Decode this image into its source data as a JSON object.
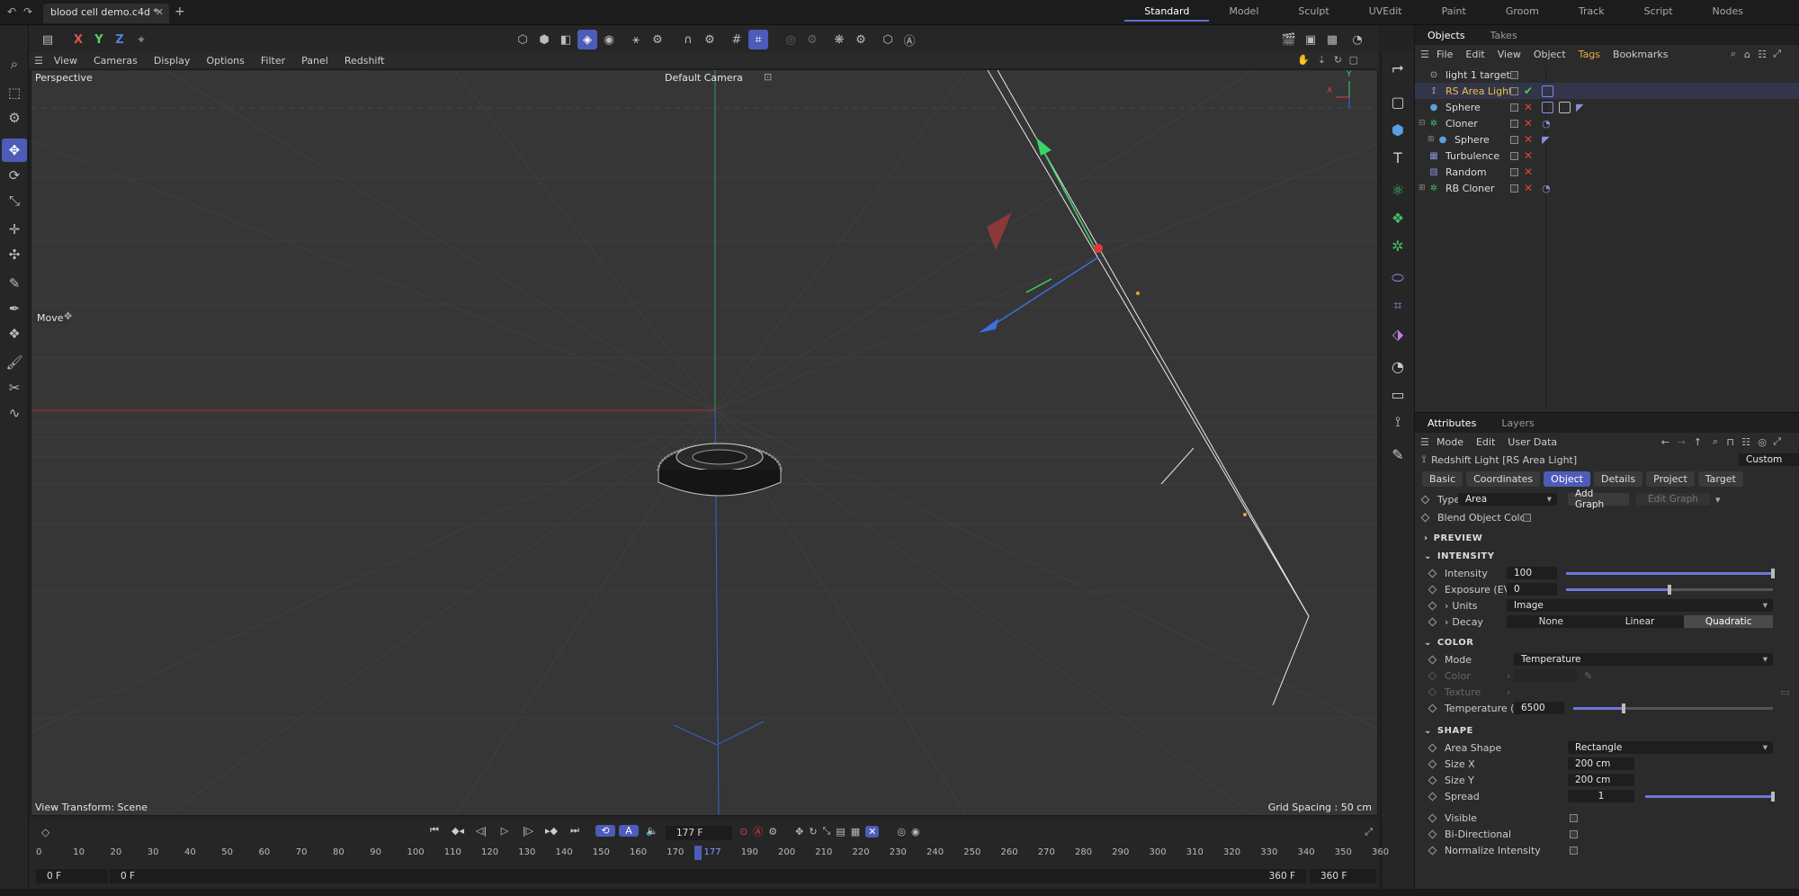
{
  "titlebar": {
    "doc_tab": "blood cell demo.c4d *",
    "layouts": [
      "Standard",
      "Model",
      "Sculpt",
      "UVEdit",
      "Paint",
      "Groom",
      "Track",
      "Script",
      "Nodes"
    ],
    "active_layout": "Standard"
  },
  "axis_buttons": {
    "x": "X",
    "y": "Y",
    "z": "Z"
  },
  "viewport_menu": [
    "View",
    "Cameras",
    "Display",
    "Options",
    "Filter",
    "Panel",
    "Redshift"
  ],
  "viewport": {
    "projection": "Perspective",
    "camera": "Default Camera",
    "tool_label": "Move",
    "view_transform": "View Transform: Scene",
    "grid_spacing": "Grid Spacing : 50 cm",
    "axis_x": "X",
    "axis_y": "Y"
  },
  "objects_panel": {
    "tabs": [
      "Objects",
      "Takes"
    ],
    "menu": [
      "File",
      "Edit",
      "View",
      "Object",
      "Tags",
      "Bookmarks"
    ],
    "items": [
      {
        "name": "light 1 target",
        "icon": "target-icon",
        "selected": false
      },
      {
        "name": "RS Area Light",
        "icon": "light-icon",
        "selected": true
      },
      {
        "name": "Sphere",
        "icon": "sphere-icon",
        "selected": false
      },
      {
        "name": "Cloner",
        "icon": "cloner-icon",
        "selected": false
      },
      {
        "name": "Sphere",
        "icon": "sphere-icon",
        "selected": false
      },
      {
        "name": "Turbulence",
        "icon": "turbulence-icon",
        "selected": false
      },
      {
        "name": "Random",
        "icon": "random-icon",
        "selected": false
      },
      {
        "name": "RB Cloner",
        "icon": "cloner-icon",
        "selected": false
      }
    ]
  },
  "attributes_panel": {
    "tabs": [
      "Attributes",
      "Layers"
    ],
    "menu": [
      "Mode",
      "Edit",
      "User Data"
    ],
    "object_title": "Redshift Light [RS Area Light]",
    "preset": "Custom",
    "attr_tabs": [
      "Basic",
      "Coordinates",
      "Object",
      "Details",
      "Project",
      "Target"
    ],
    "active_attr_tab": "Object",
    "type_label": "Type",
    "type_value": "Area",
    "add_graph": "Add Graph",
    "edit_graph": "Edit Graph",
    "blend_object_color": "Blend Object Color",
    "sections": {
      "preview": "PREVIEW",
      "intensity": "INTENSITY",
      "color": "COLOR",
      "shape": "SHAPE"
    },
    "intensity": {
      "intensity_label": "Intensity",
      "intensity_value": "100",
      "intensity_level": 1.0,
      "exposure_label": "Exposure (EV)",
      "exposure_value": "0",
      "exposure_level": 0.5,
      "units_label": "Units",
      "units_value": "Image",
      "decay_label": "Decay",
      "decay_options": [
        "None",
        "Linear",
        "Quadratic"
      ],
      "decay_selected": "Quadratic"
    },
    "color": {
      "mode_label": "Mode",
      "mode_value": "Temperature",
      "color_label": "Color",
      "texture_label": "Texture",
      "temperature_label": "Temperature (K)",
      "temperature_value": "6500",
      "temperature_level": 0.25
    },
    "shape": {
      "area_shape_label": "Area Shape",
      "area_shape_value": "Rectangle",
      "size_x_label": "Size X",
      "size_x_value": "200 cm",
      "size_y_label": "Size Y",
      "size_y_value": "200 cm",
      "spread_label": "Spread",
      "spread_value": "1",
      "spread_level": 1.0,
      "visible_label": "Visible",
      "bidirectional_label": "Bi-Directional",
      "normalize_label": "Normalize Intensity"
    }
  },
  "timeline": {
    "current_frame": "177 F",
    "ticks": [
      "0",
      "10",
      "20",
      "30",
      "40",
      "50",
      "60",
      "70",
      "80",
      "90",
      "100",
      "110",
      "120",
      "130",
      "140",
      "150",
      "160",
      "170",
      "177",
      "190",
      "200",
      "210",
      "220",
      "230",
      "240",
      "250",
      "260",
      "270",
      "280",
      "290",
      "300",
      "310",
      "320",
      "330",
      "340",
      "350",
      "360"
    ],
    "start_a": "0 F",
    "start_b": "0 F",
    "end_a": "360 F",
    "end_b": "360 F"
  },
  "colors": {
    "accent": "#4d5cb8",
    "selected_text": "#f0c040",
    "x_axis": "#c83c3c",
    "y_axis": "#3cc864",
    "z_axis": "#3c6ee0"
  }
}
